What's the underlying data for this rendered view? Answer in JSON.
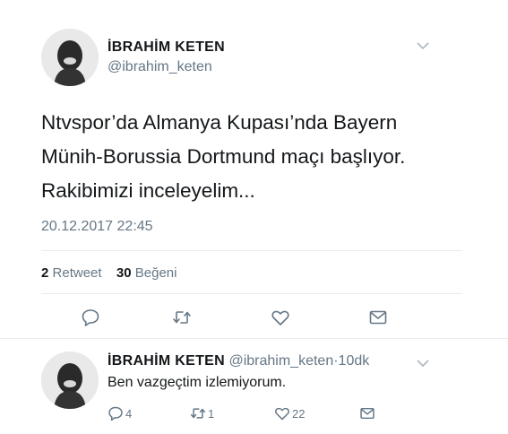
{
  "main_tweet": {
    "display_name": "İBRAHİM KETEN",
    "handle": "@ibrahim_keten",
    "text": "Ntvspor’da Almanya Kupası’nda Bayern Münih-Borussia Dortmund maçı başlıyor. Rakibimizi inceleyelim...",
    "timestamp": "20.12.2017 22:45",
    "retweet_count": "2",
    "retweet_label": "Retweet",
    "like_count": "30",
    "like_label": "Beğeni",
    "icons": [
      "reply-icon",
      "retweet-icon",
      "like-icon",
      "message-icon",
      "chevron-down-icon"
    ]
  },
  "reply_tweet": {
    "display_name": "İBRAHİM KETEN",
    "handle": "@ibrahim_keten",
    "separator": "·",
    "time_ago": "10dk",
    "text": "Ben vazgeçtim izlemiyorum.",
    "reply_count": "4",
    "retweet_count": "1",
    "like_count": "22"
  },
  "colors": {
    "text": "#14171a",
    "secondary": "#657786",
    "divider": "#e6ecf0"
  }
}
